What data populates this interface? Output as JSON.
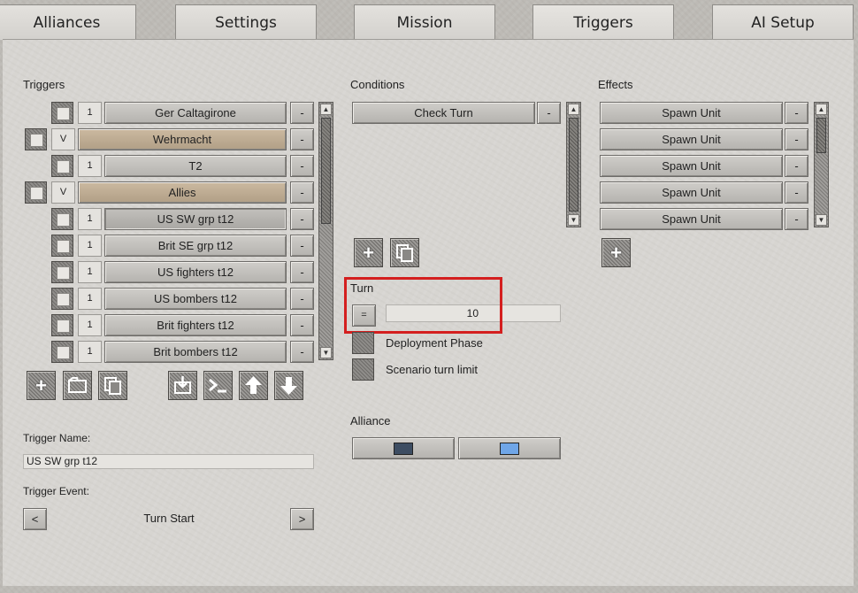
{
  "tabs": [
    "Alliances",
    "Settings",
    "Mission",
    "Triggers",
    "AI Setup"
  ],
  "active_tab": "Triggers",
  "triggers": {
    "label": "Triggers",
    "rows": [
      {
        "num": "1",
        "name": "Ger Caltagirone",
        "type": "trigger"
      },
      {
        "mark": "V",
        "name": "Wehrmacht",
        "type": "group"
      },
      {
        "num": "1",
        "name": "T2",
        "type": "trigger"
      },
      {
        "mark": "V",
        "name": "Allies",
        "type": "group"
      },
      {
        "num": "1",
        "name": "US SW grp t12",
        "type": "trigger",
        "selected": true
      },
      {
        "num": "1",
        "name": "Brit SE grp t12",
        "type": "trigger"
      },
      {
        "num": "1",
        "name": "US fighters t12",
        "type": "trigger"
      },
      {
        "num": "1",
        "name": "US bombers t12",
        "type": "trigger"
      },
      {
        "num": "1",
        "name": "Brit fighters t12",
        "type": "trigger"
      },
      {
        "num": "1",
        "name": "Brit bombers t12",
        "type": "trigger"
      }
    ],
    "remove_label": "-",
    "toolbar": [
      "add-icon",
      "folder-icon",
      "copy-icon",
      "import-icon",
      "console-icon",
      "arrow-up-icon",
      "arrow-down-icon"
    ]
  },
  "trigger_name": {
    "label": "Trigger Name:",
    "value": "US SW grp t12"
  },
  "trigger_event": {
    "label": "Trigger Event:",
    "value": "Turn Start",
    "prev": "<",
    "next": ">"
  },
  "conditions": {
    "label": "Conditions",
    "items": [
      "Check Turn"
    ],
    "remove_label": "-",
    "toolbar": [
      "add-icon",
      "copy-icon"
    ]
  },
  "turn": {
    "label": "Turn",
    "operator": "=",
    "value": "10"
  },
  "options": [
    {
      "label": "Deployment Phase",
      "checked": false
    },
    {
      "label": "Scenario turn limit",
      "checked": false
    }
  ],
  "alliance": {
    "label": "Alliance",
    "colors": [
      "#3d4d62",
      "#6fa6e8"
    ]
  },
  "effects": {
    "label": "Effects",
    "items": [
      "Spawn Unit",
      "Spawn Unit",
      "Spawn Unit",
      "Spawn Unit",
      "Spawn Unit"
    ],
    "remove_label": "-",
    "toolbar": [
      "add-icon"
    ]
  },
  "colors": {
    "highlight": "#d41f1f",
    "group_row": "#cbb9a0"
  }
}
